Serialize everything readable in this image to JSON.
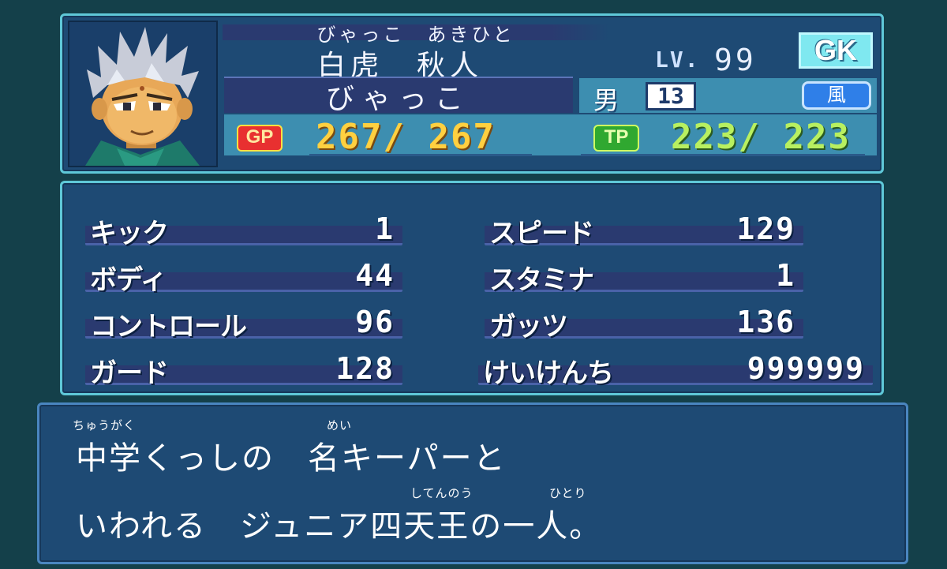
{
  "profile": {
    "reading": "びゃっこ　あきひと",
    "name": "白虎　秋人",
    "nickname": "びゃっこ",
    "level_label": "LV.",
    "level": "99",
    "position": "GK",
    "gender": "男",
    "number": "13",
    "element": "風",
    "gp_label": "GP",
    "gp": "267/ 267",
    "tp_label": "TP",
    "tp": "223/ 223"
  },
  "stats": [
    {
      "label": "キック",
      "value": "1"
    },
    {
      "label": "ボディ",
      "value": "44"
    },
    {
      "label": "コントロール",
      "value": "96"
    },
    {
      "label": "ガード",
      "value": "128"
    },
    {
      "label": "スピード",
      "value": "129"
    },
    {
      "label": "スタミナ",
      "value": "1"
    },
    {
      "label": "ガッツ",
      "value": "136"
    },
    {
      "label": "けいけんち",
      "value": "999999"
    }
  ],
  "description": {
    "ruby1a": "ちゅうがく",
    "ruby1b": "めい",
    "line1": "中学くっしの　名キーパーと",
    "ruby2a": "してんのう",
    "ruby2b": "ひとり",
    "line2": "いわれる　ジュニア四天王の一人。"
  },
  "colors": {
    "background": "#14404a",
    "panel": "#1e4a74",
    "panel_border": "#5fc8d8",
    "gp_text": "#ffd040",
    "tp_text": "#b8f060"
  }
}
